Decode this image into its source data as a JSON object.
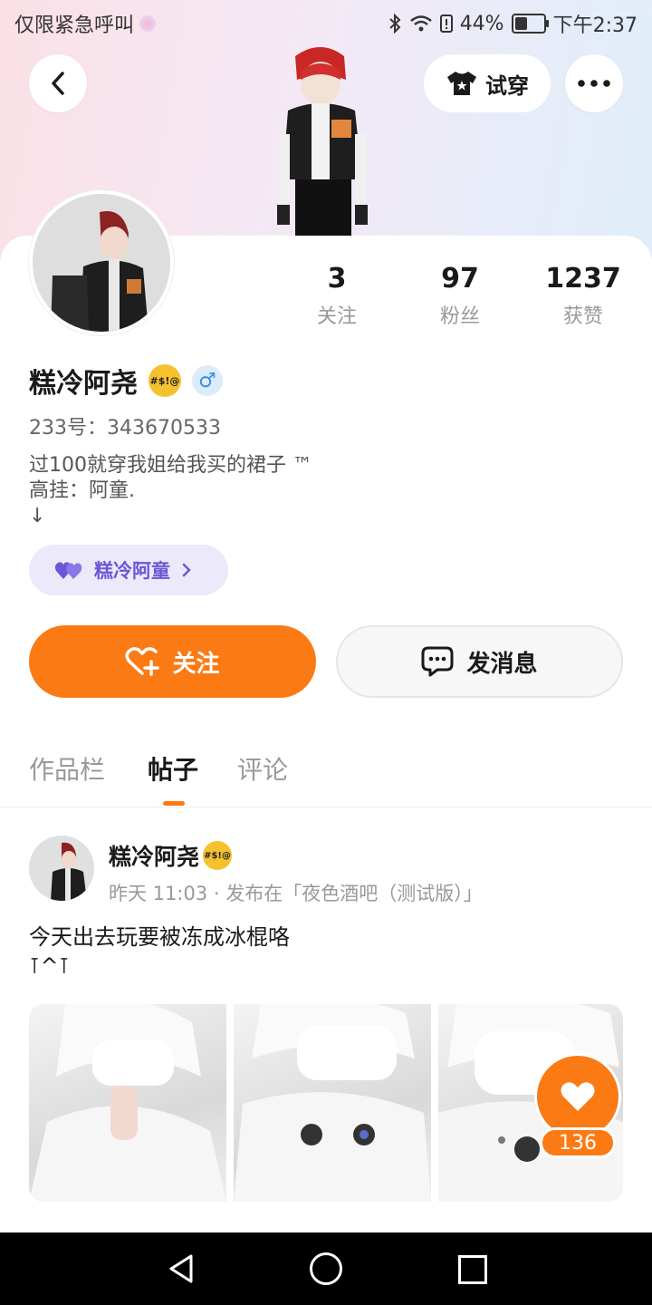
{
  "status_bar": {
    "left_text": "仅限紧急呼叫",
    "battery": "44%",
    "battery_level": 0.44,
    "time": "下午2:37"
  },
  "header": {
    "try_on_label": "试穿"
  },
  "profile": {
    "stats": [
      {
        "value": "3",
        "label": "关注"
      },
      {
        "value": "97",
        "label": "粉丝"
      },
      {
        "value": "1237",
        "label": "获赞"
      }
    ],
    "name": "糕冷阿尧",
    "name_emoji_text": "#$!@",
    "gender_symbol": "♂",
    "uid": "233号：343670533",
    "bio": "过100就穿我姐给我买的裙子 ™\n高挂：阿童.\n↓",
    "badge_label": "糕冷阿童"
  },
  "actions": {
    "follow_label": "关注",
    "message_label": "发消息"
  },
  "tabs": [
    {
      "label": "作品栏",
      "active": false
    },
    {
      "label": "帖子",
      "active": true
    },
    {
      "label": "评论",
      "active": false
    }
  ],
  "post": {
    "author": "糕冷阿尧",
    "meta": "昨天 11:03 · 发布在「夜色酒吧（测试版）」",
    "text": "今天出去玩要被冻成冰棍咯\n⊺^⊺",
    "like_count": "136"
  },
  "colors": {
    "accent": "#fb7a14",
    "badge_bg": "#ece9fb",
    "badge_text": "#6b57d6",
    "gender_blue": "#3c8ee5"
  }
}
